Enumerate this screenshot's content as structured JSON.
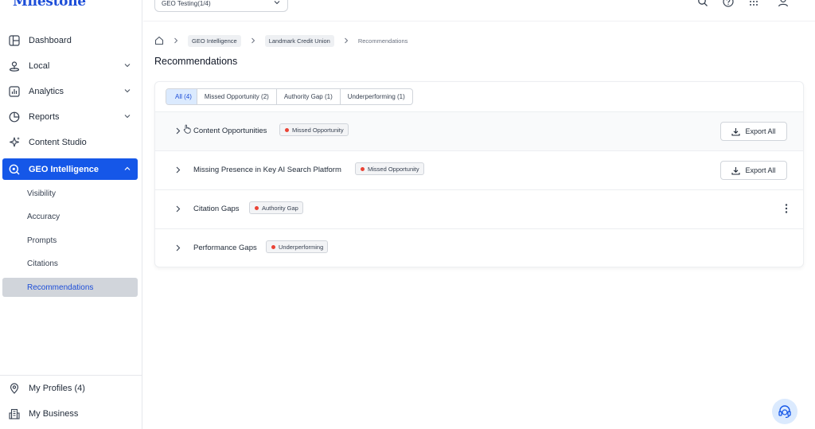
{
  "app": {
    "logo_text": "Milestone"
  },
  "sidebar": {
    "items": [
      {
        "label": "Dashboard"
      },
      {
        "label": "Local"
      },
      {
        "label": "Analytics"
      },
      {
        "label": "Reports"
      },
      {
        "label": "Content Studio"
      },
      {
        "label": "GEO Intelligence"
      }
    ],
    "subitems": [
      {
        "label": "Visibility"
      },
      {
        "label": "Accuracy"
      },
      {
        "label": "Prompts"
      },
      {
        "label": "Citations"
      },
      {
        "label": "Recommendations"
      }
    ],
    "bottom": [
      {
        "label": "My Profiles (4)"
      },
      {
        "label": "My Business"
      }
    ]
  },
  "topbar": {
    "project_value": "GEO Testing(1/4)"
  },
  "breadcrumb": {
    "items": [
      {
        "label": "GEO Intelligence"
      },
      {
        "label": "Landmark Credit Union"
      },
      {
        "label": "Recommendations"
      }
    ]
  },
  "page": {
    "title": "Recommendations"
  },
  "tabs": [
    {
      "label": "All (4)"
    },
    {
      "label": "Missed Opportunity (2)"
    },
    {
      "label": "Authority Gap (1)"
    },
    {
      "label": "Underperforming (1)"
    }
  ],
  "rows": [
    {
      "title": "Content Opportunities",
      "badge": "Missed Opportunity",
      "action": "Export All"
    },
    {
      "title": "Missing Presence in Key AI Search Platform",
      "badge": "Missed Opportunity",
      "action": "Export All"
    },
    {
      "title": "Citation Gaps",
      "badge": "Authority Gap"
    },
    {
      "title": "Performance Gaps",
      "badge": "Underperforming"
    }
  ],
  "colors": {
    "accent": "#1557e8",
    "badge_dot": "#ea4335",
    "active_tab_bg": "#dbeafe"
  }
}
